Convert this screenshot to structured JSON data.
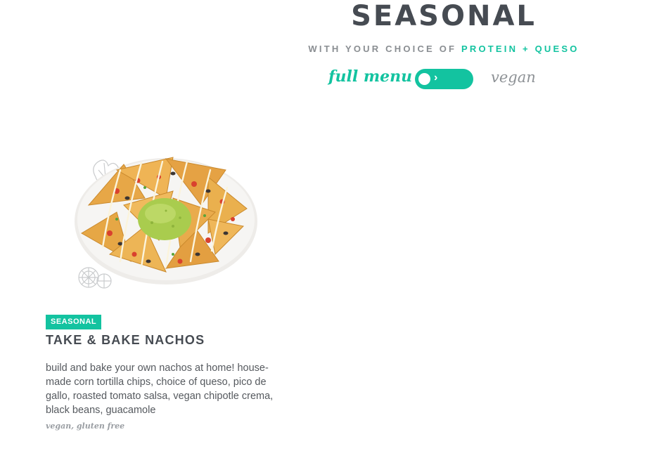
{
  "header": {
    "title": "SEASONAL",
    "subtitle_prefix": "WITH YOUR CHOICE OF",
    "subtitle_accent": "PROTEIN + QUESO"
  },
  "filter_toggle": {
    "left_label": "full menu",
    "right_label": "vegan",
    "chevron": "›",
    "state": "full menu"
  },
  "menu_item": {
    "badge": "SEASONAL",
    "title": "TAKE & BAKE NACHOS",
    "description": "build and bake your own nachos at home! house-made corn tortilla chips, choice of queso, pico de gallo, roasted tomato salsa, vegan chipotle crema, black beans, guacamole",
    "tags": "vegan, gluten free",
    "image_icon": "nachos-plate-image"
  },
  "colors": {
    "accent": "#13c3a0",
    "heading": "#464b52",
    "muted": "#8a8e92"
  }
}
